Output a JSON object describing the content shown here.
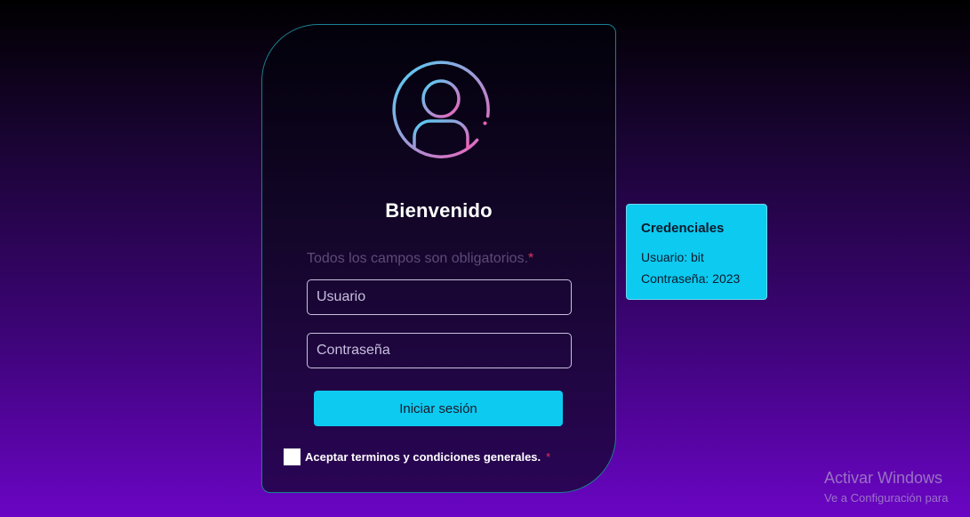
{
  "login": {
    "title": "Bienvenido",
    "required_note": "Todos los campos son obligatorios.",
    "required_marker": "*",
    "username_placeholder": "Usuario",
    "password_placeholder": "Contraseña",
    "submit_label": "Iniciar sesión",
    "terms_label": "Aceptar terminos y condiciones generales.",
    "terms_marker": "*",
    "avatar_icon": "user-circle-icon"
  },
  "credentials": {
    "title": "Credenciales",
    "username_line": "Usuario: bit",
    "password_line": "Contraseña: 2023"
  },
  "watermark": {
    "title": "Activar Windows",
    "subtitle": "Ve a Configuración para"
  },
  "colors": {
    "accent": "#0dcaf0",
    "required": "#d9375b",
    "avatar_gradient_start": "#4fd2f5",
    "avatar_gradient_end": "#f25fb8"
  }
}
